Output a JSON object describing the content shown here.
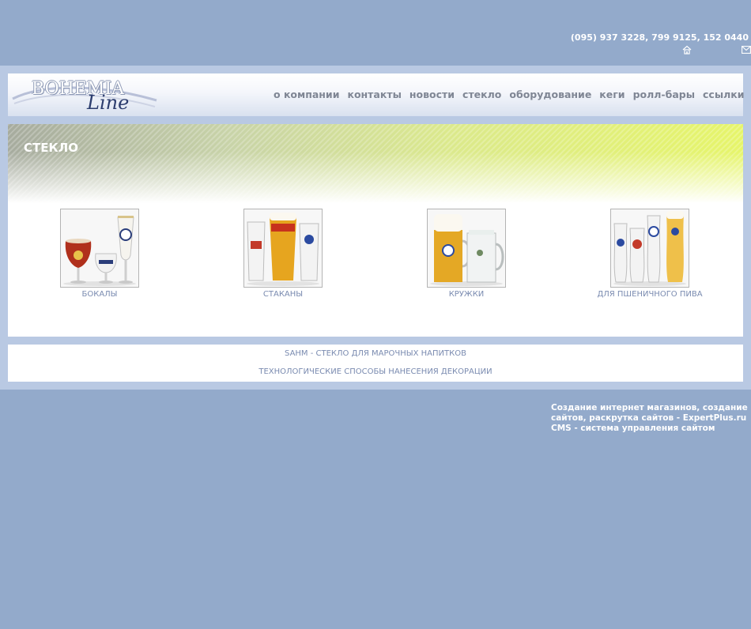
{
  "header": {
    "phones": "(095) 937 3228, 799 9125, 152 0440"
  },
  "logo": {
    "word1": "BOHEMIA",
    "word2": "Line"
  },
  "nav": {
    "items": [
      {
        "label": "о компании"
      },
      {
        "label": "контакты"
      },
      {
        "label": "новости"
      },
      {
        "label": "стекло"
      },
      {
        "label": "оборудование"
      },
      {
        "label": "кеги"
      },
      {
        "label": "ролл-бары"
      },
      {
        "label": "ссылки"
      }
    ]
  },
  "page": {
    "title": "СТЕКЛО"
  },
  "products": [
    {
      "label": "БОКАЛЫ"
    },
    {
      "label": "СТАКАНЫ"
    },
    {
      "label": "КРУЖКИ"
    },
    {
      "label": "ДЛЯ ПШЕНИЧНОГО ПИВА"
    }
  ],
  "links": [
    {
      "label": "SAHM - СТЕКЛО ДЛЯ МАРОЧНЫХ НАПИТКОВ"
    },
    {
      "label": "ТЕХНОЛОГИЧЕСКИЕ СПОСОБЫ НАНЕСЕНИЯ ДЕКОРАЦИИ"
    }
  ],
  "footer": {
    "line1": "Создание интернет магазинов, создание",
    "line2": "сайтов, раскрутка сайтов - ExpertPlus.ru",
    "line3": "CMS - система управления сайтом"
  },
  "colors": {
    "background": "#93aacb",
    "frame": "#b9c9e3",
    "link": "#7a8bb0",
    "nav": "#7f8694"
  }
}
